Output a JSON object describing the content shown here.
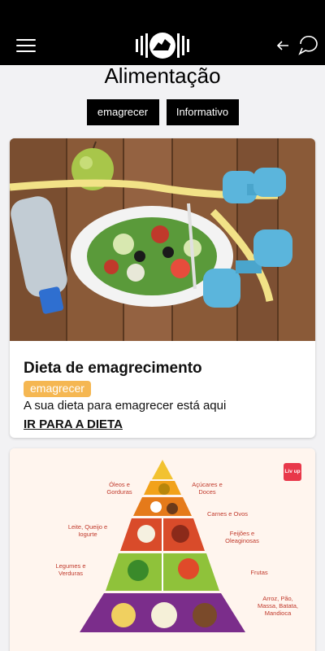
{
  "header": {
    "menu_icon": "hamburger-menu-icon",
    "logo": "rhino-logo",
    "back_icon": "back-arrow-icon",
    "chat_icon": "chat-bubble-icon"
  },
  "page": {
    "title": "Alimentação"
  },
  "filters": [
    {
      "label": "emagrecer"
    },
    {
      "label": "Informativo"
    }
  ],
  "cards": [
    {
      "title": "Dieta de emagrecimento",
      "badge": "emagrecer",
      "description": "A sua dieta para emagrecer está aqui",
      "link": "IR PARA A DIETA"
    },
    {
      "brand": "Liv up",
      "pyramid_labels": {
        "oils": "Óleos e Gorduras",
        "sugars": "Açúcares e Doces",
        "meats": "Carnes e Ovos",
        "dairy": "Leite, Queijo e Iogurte",
        "beans": "Feijões e Oleaginosas",
        "veggies": "Legumes e Verduras",
        "fruits": "Frutas",
        "grains": "Arroz, Pão, Massa, Batata, Mandioca"
      }
    }
  ],
  "colors": {
    "accent": "#f5b752",
    "header_bg": "#000000",
    "page_bg": "#f2f2f4"
  }
}
